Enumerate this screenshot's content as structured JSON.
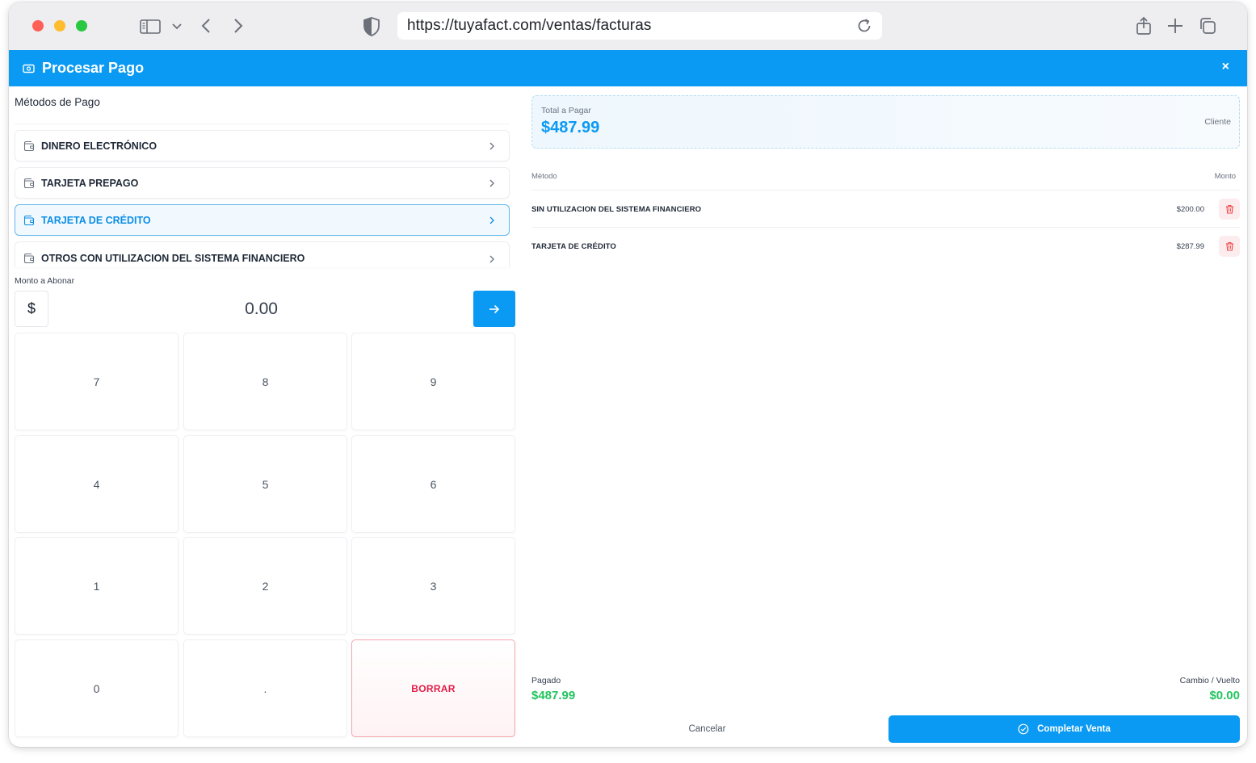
{
  "browser": {
    "url": "https://tuyafact.com/ventas/facturas",
    "icons": [
      "sidebar-icon",
      "chevron-down-icon",
      "back-icon",
      "forward-icon",
      "shield-icon",
      "reload-icon",
      "share-icon",
      "new-tab-icon",
      "tabs-icon"
    ]
  },
  "modal": {
    "title": "Procesar Pago",
    "close_label": "×"
  },
  "payment_methods": {
    "title": "Métodos de Pago",
    "items": [
      {
        "label": "DINERO ELECTRÓNICO",
        "active": false
      },
      {
        "label": "TARJETA PREPAGO",
        "active": false
      },
      {
        "label": "TARJETA DE CRÉDITO",
        "active": true
      },
      {
        "label": "OTROS CON UTILIZACION DEL SISTEMA FINANCIERO",
        "active": false
      }
    ]
  },
  "amount": {
    "label": "Monto a Abonar",
    "currency": "$",
    "value": "0.00"
  },
  "keypad": {
    "keys": [
      "7",
      "8",
      "9",
      "4",
      "5",
      "6",
      "1",
      "2",
      "3",
      "0",
      ".",
      "BORRAR"
    ]
  },
  "summary": {
    "total_label": "Total a Pagar",
    "total_value": "$487.99",
    "client_label": "Cliente",
    "col_method": "Método",
    "col_amount": "Monto",
    "rows": [
      {
        "method": "SIN UTILIZACION DEL SISTEMA FINANCIERO",
        "amount": "$200.00"
      },
      {
        "method": "TARJETA DE CRÉDITO",
        "amount": "$287.99"
      }
    ],
    "paid_label": "Pagado",
    "paid_value": "$487.99",
    "change_label": "Cambio / Vuelto",
    "change_value": "$0.00",
    "cancel_label": "Cancelar",
    "complete_label": "Completar Venta"
  },
  "colors": {
    "primary": "#0b9af3",
    "success": "#22c55e",
    "danger": "#e11d48"
  }
}
